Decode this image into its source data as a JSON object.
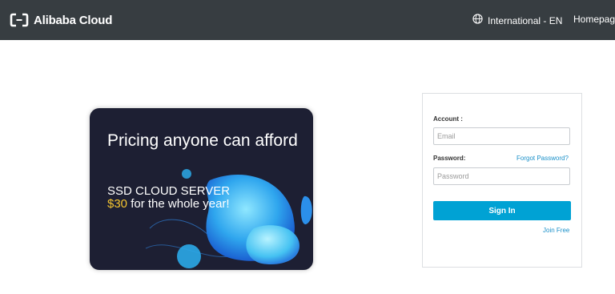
{
  "header": {
    "logo_text": "Alibaba Cloud",
    "language": "International - EN",
    "homepage_link": "Homepage",
    "background": "#373d41"
  },
  "banner": {
    "headline": "Pricing anyone can afford",
    "subtitle": "SSD CLOUD SERVER",
    "price": "$30",
    "offer_suffix": " for the whole year!",
    "background": "#1d1f33",
    "price_color": "#f4c430"
  },
  "login": {
    "account_label": "Account :",
    "email_placeholder": "Email",
    "password_label": "Password:",
    "forgot_password": "Forgot Password?",
    "password_placeholder": "Password",
    "signin_label": "Sign In",
    "join_free": "Join Free",
    "button_color": "#00a2d4",
    "link_color": "#1a90c9"
  }
}
